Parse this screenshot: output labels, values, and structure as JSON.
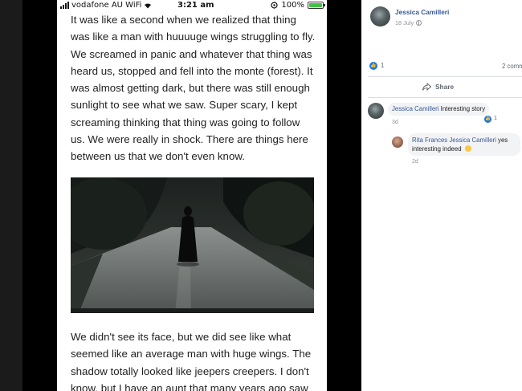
{
  "status_bar": {
    "carrier": "vodafone AU WiFi",
    "time": "3:21 am",
    "battery_percent": "100%",
    "icons": [
      "signal-icon",
      "wifi-icon",
      "location-icon",
      "battery-icon"
    ]
  },
  "story": {
    "paragraph_1": "It was like a second when we realized that thing was like a man with huuuuge wings struggling to fly. We screamed in panic and whatever that thing was heard us, stopped and fell into the monte (forest). It was almost getting dark, but there was still enough sunlight to see what we saw. Super scary, I kept screaming thinking that thing was going to follow us. We were really in shock. There are things here between us that we don't even know.",
    "paragraph_2": "We didn't see its face, but we did see like what seemed like an average man with huge wings. The shadow totally looked like jeepers creepers. I don't know, but I have an aunt that many years ago saw"
  },
  "post": {
    "author": "Jessica Camilleri",
    "date": "18 July",
    "like_count": "1",
    "comment_count": "2 comm",
    "share_label": "Share"
  },
  "comments": [
    {
      "author": "Jessica Camilleri",
      "text": "Interesting story",
      "like_count": "1",
      "time": "3d"
    },
    {
      "author": "Rita Frances",
      "mention": "Jessica Camilleri",
      "text": "yes interesting indeed",
      "time": "2d"
    }
  ],
  "colors": {
    "link_blue": "#385898",
    "like_blue": "#1877f2",
    "meta_gray": "#8d949e",
    "battery_green": "#3ec43e"
  }
}
